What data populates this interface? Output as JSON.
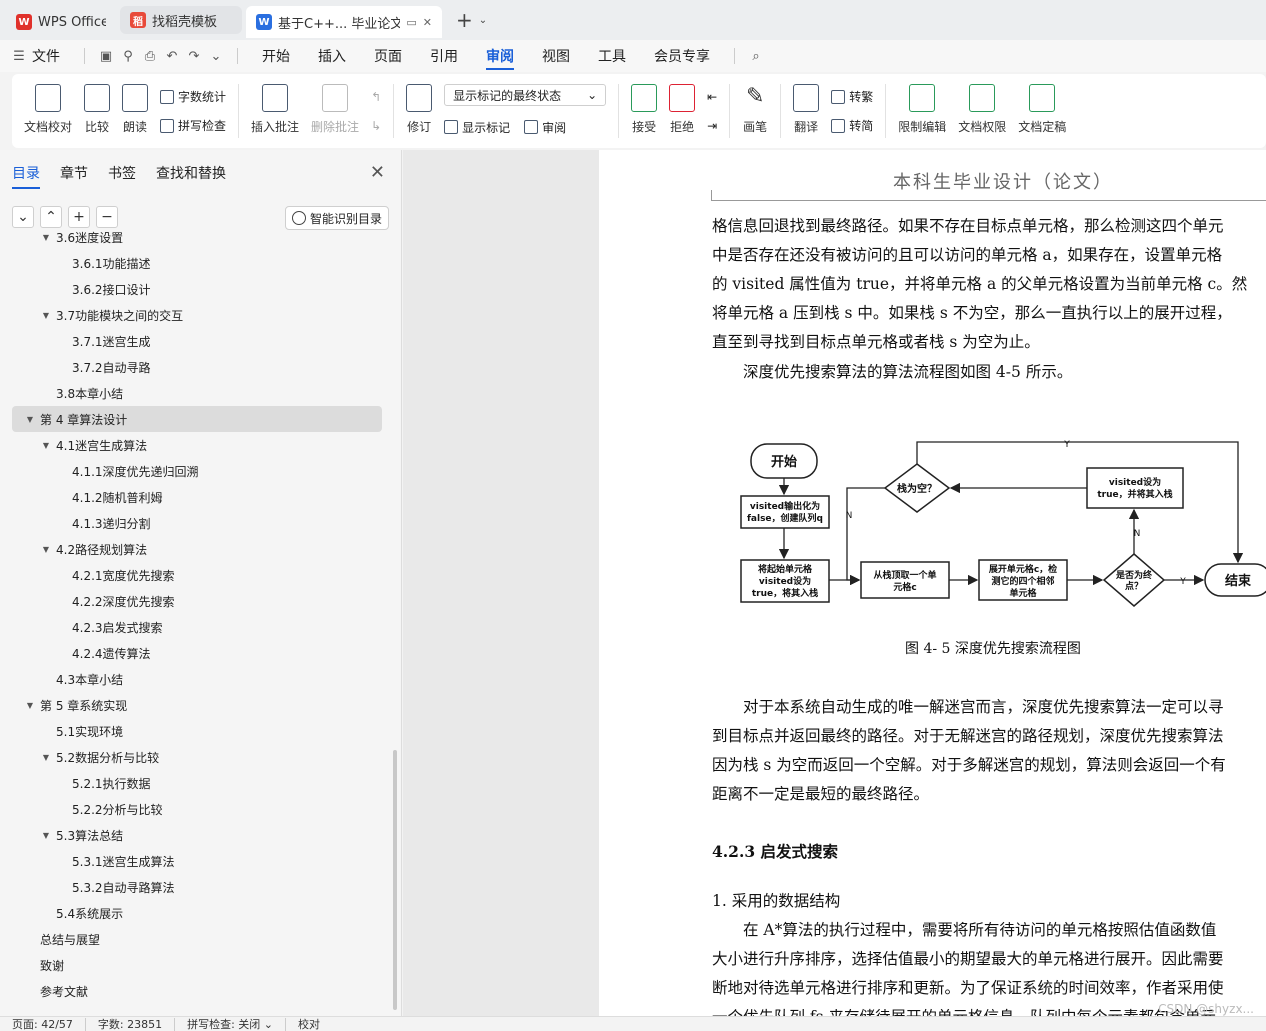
{
  "tabs": {
    "home": "WPS Office",
    "template": "找稻壳模板",
    "doc": "基于C++... 毕业论文"
  },
  "menu": {
    "file": "文件",
    "items": [
      "开始",
      "插入",
      "页面",
      "引用",
      "审阅",
      "视图",
      "工具",
      "会员专享"
    ],
    "active": "审阅"
  },
  "ribbon": {
    "doc_check": "文档校对",
    "compare": "比较",
    "read_aloud": "朗读",
    "word_count": "字数统计",
    "spell_check": "拼写检查",
    "insert_comment": "插入批注",
    "delete_comment": "删除批注",
    "revise": "修订",
    "markup_select": "显示标记的最终状态",
    "show_markup": "显示标记",
    "review": "审阅",
    "accept": "接受",
    "reject": "拒绝",
    "pen": "画笔",
    "translate": "翻译",
    "to_traditional": "转繁",
    "to_simplified": "转简",
    "restrict_edit": "限制编辑",
    "doc_rights": "文档权限",
    "doc_finalize": "文档定稿"
  },
  "nav": {
    "tabs": [
      "目录",
      "章节",
      "书签",
      "查找和替换"
    ],
    "smart_toc": "智能识别目录",
    "toc": [
      {
        "level": 2,
        "label": "3.6迷度设置",
        "tri": "▼"
      },
      {
        "level": 3,
        "label": "3.6.1功能描述"
      },
      {
        "level": 3,
        "label": "3.6.2接口设计"
      },
      {
        "level": 2,
        "label": "3.7功能模块之间的交互",
        "tri": "▼"
      },
      {
        "level": 3,
        "label": "3.7.1迷宫生成"
      },
      {
        "level": 3,
        "label": "3.7.2自动寻路"
      },
      {
        "level": 2,
        "label": "3.8本章小结"
      },
      {
        "level": 1,
        "label": "第 4 章算法设计",
        "tri": "▼",
        "selected": true
      },
      {
        "level": 2,
        "label": "4.1迷宫生成算法",
        "tri": "▼"
      },
      {
        "level": 3,
        "label": "4.1.1深度优先递归回溯"
      },
      {
        "level": 3,
        "label": "4.1.2随机普利姆"
      },
      {
        "level": 3,
        "label": "4.1.3递归分割"
      },
      {
        "level": 2,
        "label": "4.2路径规划算法",
        "tri": "▼"
      },
      {
        "level": 3,
        "label": "4.2.1宽度优先搜索"
      },
      {
        "level": 3,
        "label": "4.2.2深度优先搜索"
      },
      {
        "level": 3,
        "label": "4.2.3启发式搜索"
      },
      {
        "level": 3,
        "label": "4.2.4遗传算法"
      },
      {
        "level": 2,
        "label": "4.3本章小结"
      },
      {
        "level": 1,
        "label": "第 5 章系统实现",
        "tri": "▼"
      },
      {
        "level": 2,
        "label": "5.1实现环境"
      },
      {
        "level": 2,
        "label": "5.2数据分析与比较",
        "tri": "▼"
      },
      {
        "level": 3,
        "label": "5.2.1执行数据"
      },
      {
        "level": 3,
        "label": "5.2.2分析与比较"
      },
      {
        "level": 2,
        "label": "5.3算法总结",
        "tri": "▼"
      },
      {
        "level": 3,
        "label": "5.3.1迷宫生成算法"
      },
      {
        "level": 3,
        "label": "5.3.2自动寻路算法"
      },
      {
        "level": 2,
        "label": "5.4系统展示"
      },
      {
        "level": 1,
        "label": "总结与展望"
      },
      {
        "level": 1,
        "label": "致谢"
      },
      {
        "level": 1,
        "label": "参考文献"
      }
    ]
  },
  "doc": {
    "header": "本科生毕业设计（论文）",
    "lines": [
      "格信息回退找到最终路径。如果不存在目标点单元格，那么检测这四个单元",
      "中是否存在还没有被访问的且可以访问的单元格 a，如果存在，设置单元格",
      "的 visited 属性值为 true，并将单元格 a 的父单元格设置为当前单元格 c。然",
      "将单元格 a 压到栈 s 中。如果栈 s 不为空，那么一直执行以上的展开过程，",
      "直至到寻找到目标点单元格或者栈 s 为空为止。",
      "　　深度优先搜索算法的算法流程图如图 4-5 所示。"
    ],
    "caption": "图 4- 5  深度优先搜索流程图",
    "lines2": [
      "　　对于本系统自动生成的唯一解迷宫而言，深度优先搜索算法一定可以寻",
      "到目标点并返回最终的路径。对于无解迷宫的路径规划，深度优先搜索算法",
      "因为栈 s 为空而返回一个空解。对于多解迷宫的规划，算法则会返回一个有",
      "距离不一定是最短的最终路径。"
    ],
    "heading": "4.2.3   启发式搜索",
    "lines3": [
      "1.   采用的数据结构",
      "　　在 A*算法的执行过程中，需要将所有待访问的单元格按照估值函数值",
      "大小进行升序排序，选择估值最小的期望最大的单元格进行展开。因此需要",
      "断地对待选单元格进行排序和更新。为了保证系统的时间效率，作者采用使",
      "一个优先队列 fs 来存储待展开的单元格信息，队列中每个元素都包含单元"
    ]
  },
  "flow": {
    "start": "开始",
    "init": [
      "visited输出化为",
      "false，创建队列q"
    ],
    "push_start": [
      "将起始单元格",
      "visited设为",
      "true，将其入栈"
    ],
    "pop": [
      "从栈顶取一个单",
      "元格c"
    ],
    "expand": [
      "展开单元格c，检",
      "测它的四个相邻",
      "单元格"
    ],
    "is_target": [
      "是否为终",
      "点？"
    ],
    "end": "结束",
    "stack_empty": "栈为空？",
    "set_visited": [
      "visited设为",
      "true，并将其入栈"
    ],
    "y": "Y",
    "n": "N"
  },
  "status": {
    "page": "页面: 42/57",
    "words": "字数: 23851",
    "spell": "拼写检查: 关闭 ⌄",
    "proof": "校对"
  },
  "watermark": "CSDN @shyzx..."
}
